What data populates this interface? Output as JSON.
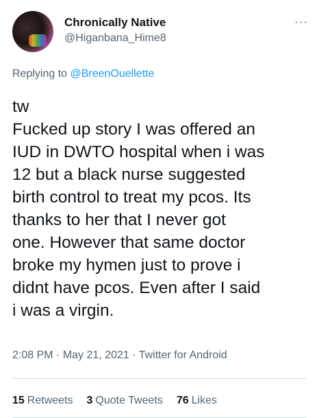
{
  "author": {
    "display_name": "Chronically Native",
    "handle": "@Higanbana_Hime8",
    "avatar_icon": "avatar-image"
  },
  "more_menu": {
    "icon": "more-icon",
    "glyph": "···"
  },
  "reply": {
    "prefix": "Replying to",
    "mention": "@BreenOuellette"
  },
  "tweet": {
    "text": "tw\nFucked up story I was offered an\nIUD in DWTO hospital when i was\n12 but a black nurse suggested\nbirth control to treat my pcos. Its\nthanks to her that I never got\none. However that same doctor\nbroke my hymen just to prove i\ndidnt have pcos. Even after I said\ni was a virgin."
  },
  "meta": {
    "time": "2:08 PM",
    "date": "May 21, 2021",
    "source": "Twitter for Android",
    "separator": "·"
  },
  "stats": {
    "retweets_count": "15",
    "retweets_label": "Retweets",
    "quotes_count": "3",
    "quotes_label": "Quote Tweets",
    "likes_count": "76",
    "likes_label": "Likes"
  },
  "colors": {
    "text": "#0f1419",
    "secondary": "#536471",
    "accent": "#1d9bf0",
    "border": "#cfd9de"
  }
}
